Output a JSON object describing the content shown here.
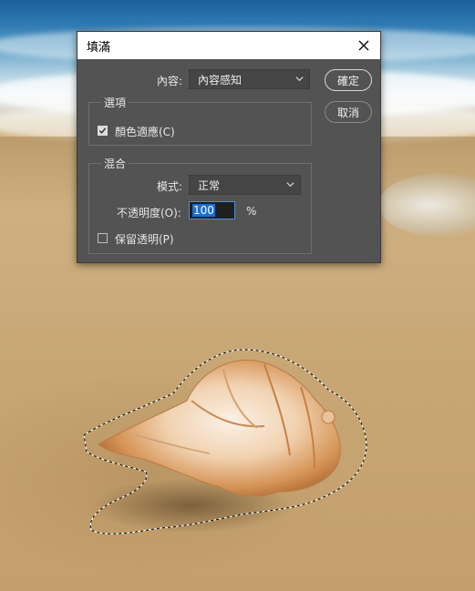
{
  "dialog": {
    "title": "填滿",
    "ok_label": "確定",
    "cancel_label": "取消",
    "contents": {
      "label": "內容:",
      "value": "內容感知"
    },
    "options": {
      "legend": "選項",
      "color_adaptation": {
        "label": "顏色適應(C)",
        "checked": true
      }
    },
    "blending": {
      "legend": "混合",
      "mode_label": "模式:",
      "mode_value": "正常",
      "opacity_label": "不透明度(O):",
      "opacity_value": "100",
      "opacity_unit": "%",
      "preserve_transparency": {
        "label": "保留透明(P)",
        "checked": false
      }
    }
  },
  "icons": {
    "close": "close-icon",
    "dropdown": "chevron-down-icon",
    "check": "check-icon"
  },
  "colors": {
    "dialog_bg": "#535353",
    "titlebar_bg": "#ffffff",
    "selection_highlight": "#1a6fd1"
  }
}
